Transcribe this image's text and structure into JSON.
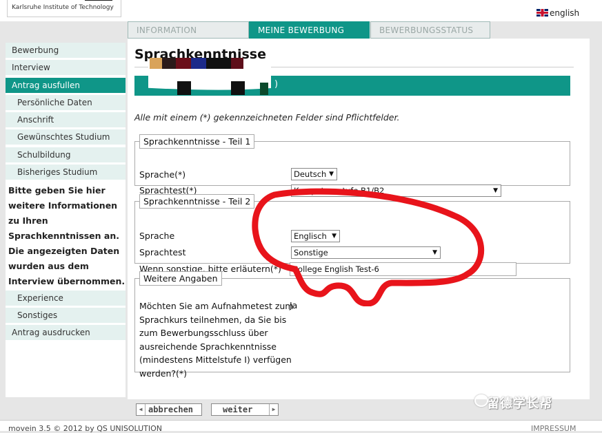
{
  "header": {
    "logo_text": "Karlsruhe Institute of Technology",
    "language_link": "english",
    "tabs": [
      {
        "label": "INFORMATION",
        "state": "inactive"
      },
      {
        "label": "MEINE BEWERBUNG",
        "state": "active"
      },
      {
        "label": "BEWERBUNGSSTATUS",
        "state": "inactive"
      }
    ]
  },
  "sidebar": {
    "items": [
      {
        "label": "Bewerbung"
      },
      {
        "label": "Interview"
      },
      {
        "label": "Antrag ausfullen"
      },
      {
        "label": "Persönliche Daten"
      },
      {
        "label": "Anschrift"
      },
      {
        "label": "Gewünschtes Studium"
      },
      {
        "label": "Schulbildung"
      },
      {
        "label": "Bisheriges Studium"
      },
      {
        "label": "Experience"
      },
      {
        "label": "Sonstiges"
      },
      {
        "label": "Antrag ausdrucken"
      }
    ],
    "info": "Bitte geben Sie hier weitere Informationen zu Ihren Sprachkenntnissen an. Die angezeigten Daten wurden aus dem Interview übernommen."
  },
  "main": {
    "title": "Sprachkenntnisse",
    "teal_bar_suffix": ")",
    "required_note": "Alle mit einem (*) gekennzeichneten Felder sind Pflichtfelder.",
    "section1": {
      "legend": "Sprachkenntnisse - Teil 1",
      "language_label": "Sprache(*)",
      "language_value": "Deutsch",
      "test_label": "Sprachtest(*)",
      "test_value": "Kompetenzstufe B1/B2"
    },
    "section2": {
      "legend": "Sprachkenntnisse - Teil 2",
      "language_label": "Sprache",
      "language_value": "Englisch",
      "test_label": "Sprachtest",
      "test_value": "Sonstige",
      "other_label": "Wenn sonstige, bitte erläutern(*)",
      "other_value": "College English Test-6"
    },
    "section3": {
      "legend": "Weitere Angaben",
      "question": "Möchten Sie am Aufnahmetest zum Sprachkurs teilnehmen, da Sie bis zum Bewerbungsschluss über ausreichende Sprachkenntnisse (mindestens Mittelstufe I) verfügen werden?(*)",
      "answer": "Ja"
    },
    "buttons": {
      "cancel": "abbrechen",
      "next": "weiter"
    }
  },
  "footer": {
    "left": "movein 3.5 © 2012 by QS UNISOLUTION",
    "right": "IMPRESSUM"
  },
  "watermark": "留德学长帮",
  "colors": {
    "accent": "#0f9688",
    "nav_background": "#e4f1ef",
    "annotation": "#e8141b"
  }
}
